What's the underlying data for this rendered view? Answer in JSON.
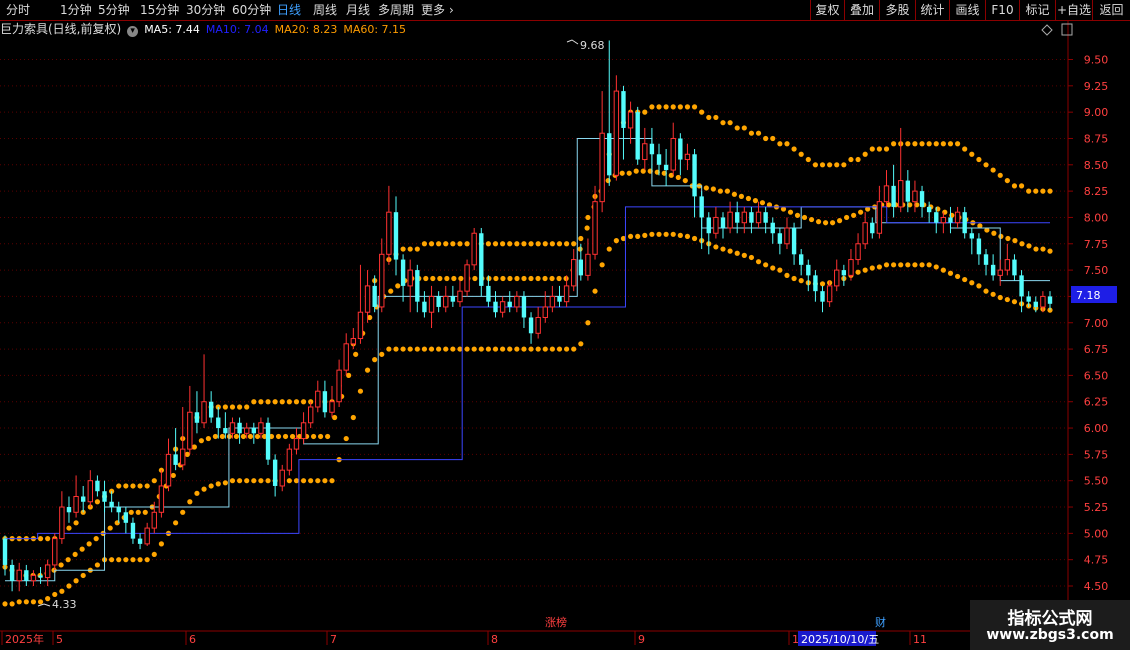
{
  "toolbar": {
    "periods": [
      "分时",
      "1分钟",
      "5分钟",
      "15分钟",
      "30分钟",
      "60分钟",
      "日线",
      "周线",
      "月线",
      "多周期",
      "更多"
    ],
    "active_period": "日线",
    "right_buttons": [
      "复权",
      "叠加",
      "多股",
      "统计",
      "画线",
      "F10",
      "标记",
      "+自选",
      "返回"
    ]
  },
  "info": {
    "title": "巨力索具(日线,前复权)",
    "ma5": "MA5: 7.44",
    "ma10": "MA10: 7.04",
    "ma20": "MA20: 8.23",
    "ma60": "MA60: 7.15"
  },
  "colors": {
    "up": "#ff3232",
    "down": "#54fcfc",
    "band": "#ffa500",
    "ma5": "#ffffff",
    "ma10": "#ffff00",
    "ma20": "#ff9c00",
    "ma60": "#ff00ff",
    "cyan_line": "#8ad8f0",
    "blue_line": "#3c46ff",
    "axis": "#8b0000",
    "price_tag": "#1e1ee6"
  },
  "markers": {
    "high_label": "9.68",
    "low_label": "4.33",
    "event_zhangbang": "涨榜",
    "event_cai": "财",
    "current_price": "7.18",
    "date_box": "2025/10/10/五"
  },
  "watermark": {
    "line1": "指标公式网",
    "line2": "www.zbgs3.com"
  },
  "chart_data": {
    "type": "candlestick",
    "y_ticks": [
      "4.50",
      "4.75",
      "5.00",
      "5.25",
      "5.50",
      "5.75",
      "6.00",
      "6.25",
      "6.50",
      "6.75",
      "7.00",
      "7.25",
      "7.50",
      "7.75",
      "8.00",
      "8.25",
      "8.50",
      "8.75",
      "9.00",
      "9.25",
      "9.50"
    ],
    "x_labels": [
      "2025年",
      "5",
      "6",
      "7",
      "8",
      "9",
      "1",
      "11"
    ],
    "ylim": [
      4.3,
      9.85
    ],
    "candles": [
      [
        4.95,
        4.7,
        4.98,
        4.6
      ],
      [
        4.7,
        4.55,
        4.75,
        4.45
      ],
      [
        4.55,
        4.65,
        4.72,
        4.45
      ],
      [
        4.65,
        4.55,
        4.7,
        4.5
      ],
      [
        4.55,
        4.6,
        4.65,
        4.5
      ],
      [
        4.6,
        4.58,
        4.68,
        4.52
      ],
      [
        4.58,
        4.7,
        4.75,
        4.5
      ],
      [
        4.7,
        4.95,
        5.0,
        4.65
      ],
      [
        4.95,
        5.25,
        5.4,
        4.9
      ],
      [
        5.25,
        5.2,
        5.35,
        5.1
      ],
      [
        5.2,
        5.35,
        5.55,
        5.15
      ],
      [
        5.35,
        5.3,
        5.45,
        5.2
      ],
      [
        5.3,
        5.5,
        5.6,
        5.25
      ],
      [
        5.5,
        5.4,
        5.55,
        5.35
      ],
      [
        5.4,
        5.3,
        5.5,
        5.2
      ],
      [
        5.3,
        5.25,
        5.4,
        5.2
      ],
      [
        5.25,
        5.2,
        5.3,
        5.1
      ],
      [
        5.2,
        5.1,
        5.25,
        5.0
      ],
      [
        5.1,
        4.95,
        5.15,
        4.9
      ],
      [
        4.95,
        4.9,
        5.0,
        4.85
      ],
      [
        4.9,
        5.05,
        5.1,
        4.88
      ],
      [
        5.05,
        5.2,
        5.3,
        5.0
      ],
      [
        5.2,
        5.45,
        5.6,
        5.15
      ],
      [
        5.45,
        5.75,
        5.9,
        5.4
      ],
      [
        5.75,
        5.65,
        6.0,
        5.6
      ],
      [
        5.65,
        5.8,
        6.2,
        5.6
      ],
      [
        5.8,
        6.15,
        6.4,
        5.75
      ],
      [
        6.15,
        6.05,
        6.35,
        5.95
      ],
      [
        6.05,
        6.25,
        6.7,
        6.0
      ],
      [
        6.25,
        6.1,
        6.35,
        6.05
      ],
      [
        6.1,
        6.0,
        6.2,
        5.9
      ],
      [
        6.0,
        5.95,
        6.15,
        5.9
      ],
      [
        5.95,
        6.05,
        6.1,
        5.9
      ],
      [
        6.05,
        5.95,
        6.1,
        5.85
      ],
      [
        5.95,
        6.0,
        6.05,
        5.9
      ],
      [
        6.0,
        5.95,
        6.05,
        5.85
      ],
      [
        5.95,
        6.05,
        6.1,
        5.9
      ],
      [
        6.05,
        5.7,
        6.1,
        5.65
      ],
      [
        5.7,
        5.45,
        5.75,
        5.35
      ],
      [
        5.45,
        5.6,
        5.65,
        5.4
      ],
      [
        5.6,
        5.8,
        5.85,
        5.55
      ],
      [
        5.8,
        5.9,
        6.0,
        5.75
      ],
      [
        5.9,
        6.05,
        6.15,
        5.85
      ],
      [
        6.05,
        6.2,
        6.25,
        6.0
      ],
      [
        6.2,
        6.35,
        6.45,
        6.15
      ],
      [
        6.35,
        6.15,
        6.45,
        6.1
      ],
      [
        6.15,
        6.25,
        6.4,
        6.1
      ],
      [
        6.25,
        6.55,
        6.65,
        6.2
      ],
      [
        6.55,
        6.8,
        6.9,
        6.5
      ],
      [
        6.8,
        6.85,
        6.95,
        6.75
      ],
      [
        6.85,
        7.1,
        7.55,
        6.8
      ],
      [
        7.1,
        7.35,
        7.5,
        7.0
      ],
      [
        7.35,
        7.15,
        7.45,
        7.1
      ],
      [
        7.15,
        7.65,
        7.8,
        7.1
      ],
      [
        7.65,
        8.05,
        8.3,
        7.55
      ],
      [
        8.05,
        7.6,
        8.2,
        7.45
      ],
      [
        7.6,
        7.35,
        7.65,
        7.2
      ],
      [
        7.35,
        7.5,
        7.6,
        7.1
      ],
      [
        7.5,
        7.2,
        7.55,
        7.1
      ],
      [
        7.2,
        7.1,
        7.3,
        7.05
      ],
      [
        7.1,
        7.25,
        7.35,
        6.95
      ],
      [
        7.25,
        7.15,
        7.3,
        7.1
      ],
      [
        7.15,
        7.25,
        7.35,
        7.1
      ],
      [
        7.25,
        7.2,
        7.35,
        7.15
      ],
      [
        7.2,
        7.3,
        7.4,
        7.15
      ],
      [
        7.3,
        7.55,
        7.6,
        7.25
      ],
      [
        7.55,
        7.85,
        7.9,
        7.5
      ],
      [
        7.85,
        7.35,
        7.9,
        7.25
      ],
      [
        7.35,
        7.2,
        7.45,
        7.15
      ],
      [
        7.2,
        7.1,
        7.3,
        7.05
      ],
      [
        7.1,
        7.2,
        7.25,
        7.05
      ],
      [
        7.2,
        7.15,
        7.3,
        7.1
      ],
      [
        7.15,
        7.25,
        7.3,
        7.1
      ],
      [
        7.25,
        7.05,
        7.3,
        6.95
      ],
      [
        7.05,
        6.9,
        7.1,
        6.8
      ],
      [
        6.9,
        7.05,
        7.15,
        6.85
      ],
      [
        7.05,
        7.15,
        7.3,
        7.0
      ],
      [
        7.15,
        7.25,
        7.35,
        7.1
      ],
      [
        7.25,
        7.2,
        7.35,
        7.15
      ],
      [
        7.2,
        7.35,
        7.45,
        7.15
      ],
      [
        7.35,
        7.6,
        7.7,
        7.3
      ],
      [
        7.6,
        7.45,
        7.75,
        7.4
      ],
      [
        7.45,
        7.65,
        7.8,
        7.4
      ],
      [
        7.65,
        8.15,
        8.3,
        7.6
      ],
      [
        8.15,
        8.8,
        9.2,
        8.05
      ],
      [
        8.8,
        8.4,
        9.68,
        8.3
      ],
      [
        8.4,
        9.2,
        9.35,
        8.35
      ],
      [
        9.2,
        8.85,
        9.25,
        8.55
      ],
      [
        8.85,
        9.0,
        9.1,
        8.7
      ],
      [
        9.0,
        8.55,
        9.05,
        8.5
      ],
      [
        8.55,
        8.7,
        8.85,
        8.45
      ],
      [
        8.7,
        8.6,
        8.85,
        8.45
      ],
      [
        8.6,
        8.5,
        8.7,
        8.4
      ],
      [
        8.5,
        8.45,
        8.65,
        8.3
      ],
      [
        8.45,
        8.75,
        8.9,
        8.4
      ],
      [
        8.75,
        8.55,
        8.8,
        8.4
      ],
      [
        8.55,
        8.6,
        8.7,
        8.45
      ],
      [
        8.6,
        8.2,
        8.65,
        8.0
      ],
      [
        8.2,
        8.0,
        8.25,
        7.7
      ],
      [
        8.0,
        7.85,
        8.05,
        7.65
      ],
      [
        7.85,
        8.0,
        8.1,
        7.8
      ],
      [
        8.0,
        7.9,
        8.05,
        7.8
      ],
      [
        7.9,
        8.05,
        8.15,
        7.85
      ],
      [
        8.05,
        7.95,
        8.15,
        7.85
      ],
      [
        7.95,
        8.05,
        8.1,
        7.85
      ],
      [
        8.05,
        7.95,
        8.1,
        7.85
      ],
      [
        7.95,
        8.05,
        8.15,
        7.9
      ],
      [
        8.05,
        7.95,
        8.1,
        7.85
      ],
      [
        7.95,
        7.85,
        8.0,
        7.75
      ],
      [
        7.85,
        7.75,
        7.9,
        7.65
      ],
      [
        7.75,
        7.9,
        8.0,
        7.7
      ],
      [
        7.9,
        7.65,
        7.95,
        7.55
      ],
      [
        7.65,
        7.55,
        7.7,
        7.45
      ],
      [
        7.55,
        7.45,
        7.6,
        7.3
      ],
      [
        7.45,
        7.3,
        7.5,
        7.2
      ],
      [
        7.3,
        7.2,
        7.35,
        7.1
      ],
      [
        7.2,
        7.35,
        7.4,
        7.15
      ],
      [
        7.35,
        7.5,
        7.6,
        7.3
      ],
      [
        7.5,
        7.45,
        7.55,
        7.35
      ],
      [
        7.45,
        7.6,
        7.7,
        7.4
      ],
      [
        7.6,
        7.75,
        7.85,
        7.55
      ],
      [
        7.75,
        7.95,
        8.05,
        7.7
      ],
      [
        7.95,
        7.85,
        8.0,
        7.8
      ],
      [
        7.85,
        8.15,
        8.3,
        7.8
      ],
      [
        8.15,
        8.3,
        8.45,
        8.1
      ],
      [
        8.3,
        8.1,
        8.5,
        8.0
      ],
      [
        8.1,
        8.35,
        8.85,
        8.05
      ],
      [
        8.35,
        8.15,
        8.45,
        8.05
      ],
      [
        8.15,
        8.25,
        8.35,
        8.05
      ],
      [
        8.25,
        8.1,
        8.3,
        8.0
      ],
      [
        8.1,
        8.05,
        8.15,
        7.95
      ],
      [
        8.05,
        7.95,
        8.1,
        7.85
      ],
      [
        7.95,
        8.0,
        8.05,
        7.85
      ],
      [
        8.0,
        7.95,
        8.1,
        7.85
      ],
      [
        7.95,
        8.05,
        8.1,
        7.9
      ],
      [
        8.05,
        7.85,
        8.1,
        7.8
      ],
      [
        7.85,
        7.8,
        7.9,
        7.65
      ],
      [
        7.8,
        7.65,
        7.85,
        7.55
      ],
      [
        7.65,
        7.55,
        7.7,
        7.45
      ],
      [
        7.55,
        7.45,
        7.65,
        7.4
      ],
      [
        7.45,
        7.5,
        7.6,
        7.35
      ],
      [
        7.5,
        7.6,
        7.75,
        7.45
      ],
      [
        7.6,
        7.45,
        7.65,
        7.4
      ],
      [
        7.45,
        7.25,
        7.5,
        7.1
      ],
      [
        7.25,
        7.2,
        7.3,
        7.15
      ],
      [
        7.2,
        7.15,
        7.25,
        7.1
      ],
      [
        7.15,
        7.25,
        7.3,
        7.1
      ],
      [
        7.25,
        7.18,
        7.3,
        7.12
      ]
    ],
    "band_upper": [
      4.95,
      4.95,
      4.95,
      4.95,
      4.95,
      4.95,
      4.95,
      4.95,
      5.0,
      5.05,
      5.1,
      5.2,
      5.25,
      5.3,
      5.35,
      5.4,
      5.45,
      5.45,
      5.45,
      5.45,
      5.45,
      5.5,
      5.6,
      5.7,
      5.8,
      5.9,
      6.0,
      6.1,
      6.15,
      6.2,
      6.2,
      6.2,
      6.2,
      6.2,
      6.2,
      6.25,
      6.25,
      6.25,
      6.25,
      6.25,
      6.25,
      6.25,
      6.25,
      6.25,
      6.25,
      6.25,
      6.25,
      6.4,
      6.6,
      6.8,
      7.0,
      7.2,
      7.4,
      7.5,
      7.6,
      7.65,
      7.7,
      7.7,
      7.7,
      7.75,
      7.75,
      7.75,
      7.75,
      7.75,
      7.75,
      7.75,
      7.75,
      7.75,
      7.75,
      7.75,
      7.75,
      7.75,
      7.75,
      7.75,
      7.75,
      7.75,
      7.75,
      7.75,
      7.75,
      7.75,
      7.75,
      7.8,
      8.0,
      8.2,
      8.4,
      8.6,
      8.8,
      8.9,
      9.0,
      9.0,
      9.0,
      9.05,
      9.05,
      9.05,
      9.05,
      9.05,
      9.05,
      9.05,
      9.0,
      8.95,
      8.95,
      8.9,
      8.9,
      8.85,
      8.85,
      8.8,
      8.8,
      8.75,
      8.75,
      8.7,
      8.7,
      8.65,
      8.6,
      8.55,
      8.5,
      8.5,
      8.5,
      8.5,
      8.5,
      8.55,
      8.55,
      8.6,
      8.65,
      8.65,
      8.65,
      8.7,
      8.7,
      8.7,
      8.7,
      8.7,
      8.7,
      8.7,
      8.7,
      8.7,
      8.7,
      8.65,
      8.6,
      8.55,
      8.5,
      8.45,
      8.4,
      8.35,
      8.3,
      8.3,
      8.25,
      8.25,
      8.25,
      8.25
    ],
    "band_middle": [
      4.68,
      4.65,
      4.62,
      4.6,
      4.6,
      4.6,
      4.62,
      4.65,
      4.7,
      4.75,
      4.8,
      4.85,
      4.9,
      4.95,
      5.0,
      5.05,
      5.1,
      5.15,
      5.2,
      5.2,
      5.2,
      5.25,
      5.35,
      5.45,
      5.55,
      5.65,
      5.75,
      5.82,
      5.88,
      5.9,
      5.92,
      5.92,
      5.92,
      5.92,
      5.92,
      5.92,
      5.92,
      5.92,
      5.92,
      5.92,
      5.92,
      5.92,
      5.92,
      5.92,
      5.92,
      5.92,
      5.92,
      6.1,
      6.3,
      6.5,
      6.7,
      6.9,
      7.05,
      7.15,
      7.25,
      7.3,
      7.35,
      7.4,
      7.42,
      7.42,
      7.42,
      7.42,
      7.42,
      7.42,
      7.42,
      7.42,
      7.42,
      7.42,
      7.42,
      7.42,
      7.42,
      7.42,
      7.42,
      7.42,
      7.42,
      7.42,
      7.42,
      7.42,
      7.42,
      7.42,
      7.42,
      7.5,
      7.7,
      7.9,
      8.1,
      8.25,
      8.35,
      8.4,
      8.42,
      8.42,
      8.44,
      8.44,
      8.44,
      8.43,
      8.42,
      8.4,
      8.38,
      8.35,
      8.3,
      8.3,
      8.28,
      8.27,
      8.25,
      8.25,
      8.22,
      8.2,
      8.18,
      8.16,
      8.14,
      8.12,
      8.1,
      8.08,
      8.05,
      8.02,
      8.0,
      7.98,
      7.96,
      7.95,
      7.95,
      7.97,
      8.0,
      8.02,
      8.05,
      8.08,
      8.1,
      8.12,
      8.12,
      8.12,
      8.12,
      8.12,
      8.12,
      8.12,
      8.1,
      8.08,
      8.05,
      8.02,
      8.0,
      7.98,
      7.95,
      7.92,
      7.88,
      7.85,
      7.82,
      7.8,
      7.78,
      7.75,
      7.73,
      7.7,
      7.7,
      7.68
    ],
    "band_lower": [
      4.33,
      4.33,
      4.35,
      4.35,
      4.35,
      4.35,
      4.38,
      4.42,
      4.45,
      4.5,
      4.55,
      4.6,
      4.65,
      4.7,
      4.75,
      4.75,
      4.75,
      4.75,
      4.75,
      4.75,
      4.75,
      4.8,
      4.9,
      5.0,
      5.1,
      5.2,
      5.3,
      5.38,
      5.42,
      5.45,
      5.47,
      5.48,
      5.5,
      5.5,
      5.5,
      5.5,
      5.5,
      5.5,
      5.5,
      5.5,
      5.5,
      5.5,
      5.5,
      5.5,
      5.5,
      5.5,
      5.5,
      5.7,
      5.9,
      6.1,
      6.35,
      6.55,
      6.65,
      6.7,
      6.75,
      6.75,
      6.75,
      6.75,
      6.75,
      6.75,
      6.75,
      6.75,
      6.75,
      6.75,
      6.75,
      6.75,
      6.75,
      6.75,
      6.75,
      6.75,
      6.75,
      6.75,
      6.75,
      6.75,
      6.75,
      6.75,
      6.75,
      6.75,
      6.75,
      6.75,
      6.75,
      6.8,
      7.0,
      7.3,
      7.55,
      7.7,
      7.78,
      7.8,
      7.82,
      7.82,
      7.83,
      7.84,
      7.84,
      7.84,
      7.84,
      7.83,
      7.82,
      7.8,
      7.78,
      7.75,
      7.72,
      7.7,
      7.68,
      7.66,
      7.64,
      7.62,
      7.58,
      7.55,
      7.52,
      7.5,
      7.45,
      7.42,
      7.4,
      7.38,
      7.37,
      7.37,
      7.38,
      7.4,
      7.42,
      7.45,
      7.48,
      7.5,
      7.52,
      7.53,
      7.55,
      7.55,
      7.55,
      7.55,
      7.55,
      7.55,
      7.55,
      7.53,
      7.5,
      7.47,
      7.44,
      7.41,
      7.38,
      7.35,
      7.3,
      7.27,
      7.24,
      7.22,
      7.2,
      7.18,
      7.16,
      7.14,
      7.13,
      7.12
    ],
    "cyan_steps": [
      [
        4.55,
        4.55,
        4.65,
        4.65,
        5.25,
        5.25,
        5.25,
        5.25,
        5.25,
        6.0,
        6.0,
        6.0,
        5.85,
        5.85,
        5.85,
        7.25,
        7.25,
        7.25,
        7.25,
        7.25,
        7.25,
        7.25,
        7.25,
        8.75,
        8.75,
        8.75,
        8.3,
        8.3,
        7.9,
        7.9,
        7.9,
        7.9,
        8.1,
        8.1,
        8.1,
        7.95,
        7.95,
        7.95,
        7.9,
        7.9,
        7.4,
        7.4
      ]
    ],
    "blue_steps": [
      4.95,
      5.0,
      5.0,
      5.0,
      5.0,
      5.0,
      5.0,
      5.0,
      5.0,
      5.7,
      5.7,
      5.7,
      5.7,
      5.7,
      7.15,
      7.15,
      7.15,
      7.15,
      7.15,
      8.1,
      8.1,
      8.1,
      8.1,
      8.1,
      8.1,
      8.1,
      8.1,
      7.95,
      7.95,
      7.95,
      7.95,
      7.95
    ]
  }
}
